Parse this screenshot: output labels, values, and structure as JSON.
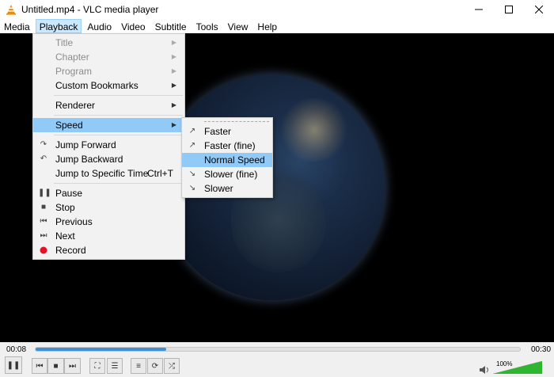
{
  "window": {
    "title": "Untitled.mp4 - VLC media player"
  },
  "menubar": [
    "Media",
    "Playback",
    "Audio",
    "Video",
    "Subtitle",
    "Tools",
    "View",
    "Help"
  ],
  "playback_menu": {
    "group1": [
      {
        "label": "Title",
        "disabled": true
      },
      {
        "label": "Chapter",
        "disabled": true
      },
      {
        "label": "Program",
        "disabled": true
      },
      {
        "label": "Custom Bookmarks",
        "disabled": false
      }
    ],
    "renderer": "Renderer",
    "speed": "Speed",
    "jump_forward": "Jump Forward",
    "jump_backward": "Jump Backward",
    "jump_specific": "Jump to Specific Time",
    "jump_specific_shortcut": "Ctrl+T",
    "pause": "Pause",
    "stop": "Stop",
    "previous": "Previous",
    "next": "Next",
    "record": "Record"
  },
  "speed_menu": {
    "faster": "Faster",
    "faster_fine": "Faster (fine)",
    "normal": "Normal Speed",
    "slower_fine": "Slower (fine)",
    "slower": "Slower"
  },
  "controls": {
    "time_elapsed": "00:08",
    "time_total": "00:30",
    "progress": 0.27,
    "volume": "100%",
    "volume_level": 1.0
  },
  "colors": {
    "highlight": "#91c9f7",
    "seek_fill": "#3f8fd8",
    "record": "#e81123",
    "volume": "#2fb52f"
  }
}
